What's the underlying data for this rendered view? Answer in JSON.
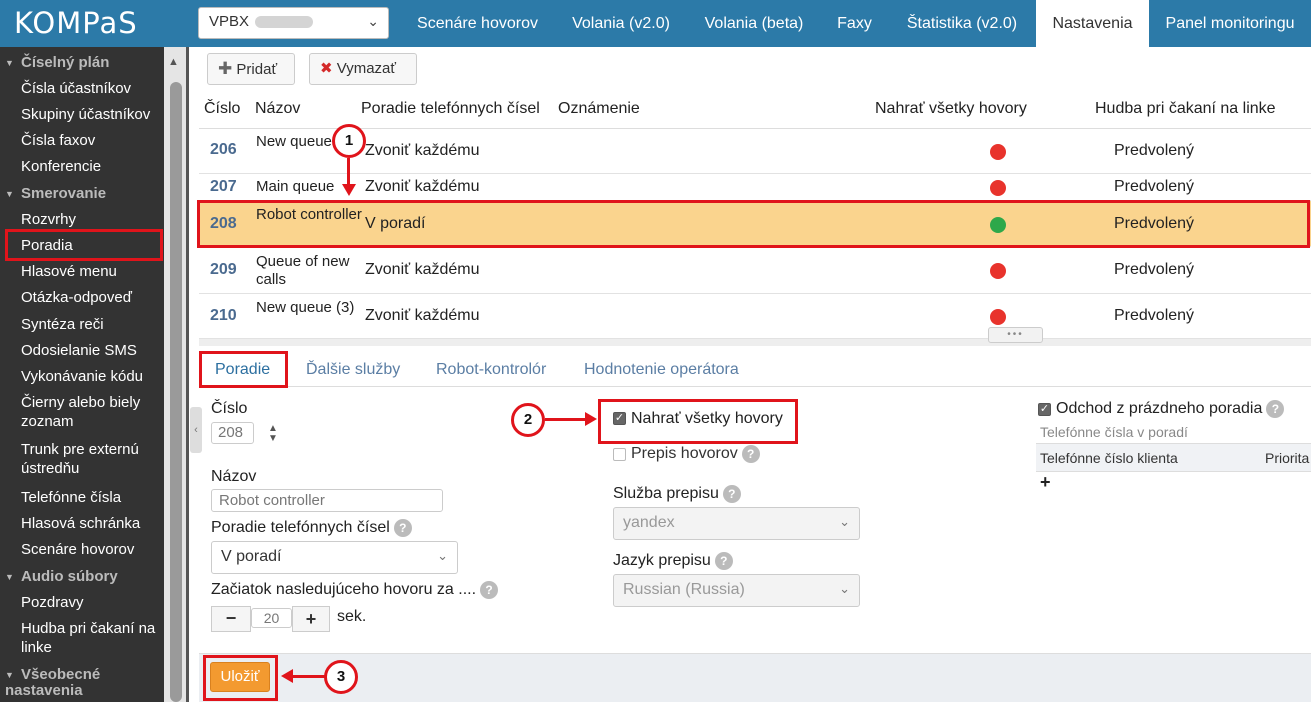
{
  "header": {
    "logo": "KOMPaS",
    "account_select": "VPBX",
    "nav_tabs": [
      "Scenáre hovorov",
      "Volania (v2.0)",
      "Volania (beta)",
      "Faxy",
      "Štatistika (v2.0)",
      "Nastavenia",
      "Panel monitoringu"
    ],
    "active_tab": "Nastavenia"
  },
  "sidebar": {
    "items": [
      {
        "label": "Číselný plán",
        "type": "section"
      },
      {
        "label": "Čísla účastníkov",
        "type": "item"
      },
      {
        "label": "Skupiny účastníkov",
        "type": "item"
      },
      {
        "label": "Čísla faxov",
        "type": "item"
      },
      {
        "label": "Konferencie",
        "type": "item"
      },
      {
        "label": "Smerovanie",
        "type": "section"
      },
      {
        "label": "Rozvrhy",
        "type": "item"
      },
      {
        "label": "Poradia",
        "type": "item",
        "active": true
      },
      {
        "label": "Hlasové menu",
        "type": "item"
      },
      {
        "label": "Otázka-odpoveď",
        "type": "item"
      },
      {
        "label": "Syntéza reči",
        "type": "item"
      },
      {
        "label": "Odosielanie SMS",
        "type": "item"
      },
      {
        "label": "Vykonávanie kódu",
        "type": "item"
      },
      {
        "label": "Čierny alebo biely zoznam",
        "type": "item"
      },
      {
        "label": "Trunk pre externú ústredňu",
        "type": "item"
      },
      {
        "label": "Telefónne čísla",
        "type": "item"
      },
      {
        "label": "Hlasová schránka",
        "type": "item"
      },
      {
        "label": "Scenáre hovorov",
        "type": "item"
      },
      {
        "label": "Audio súbory",
        "type": "section"
      },
      {
        "label": "Pozdravy",
        "type": "item"
      },
      {
        "label": "Hudba pri čakaní na linke",
        "type": "item"
      },
      {
        "label": "Všeobecné nastavenia",
        "type": "section"
      }
    ]
  },
  "toolbar": {
    "add_label": "Pridať",
    "delete_label": "Vymazať"
  },
  "table": {
    "columns": [
      "Číslo",
      "Názov",
      "Poradie telefónnych čísel",
      "Oznámenie",
      "Nahrať všetky hovory",
      "Hudba pri čakaní na linke"
    ],
    "rows": [
      {
        "number": "206",
        "name": "New queue (2)",
        "order": "Zvoniť každému",
        "record": false,
        "music": "Predvolený"
      },
      {
        "number": "207",
        "name": "Main queue",
        "order": "Zvoniť každému",
        "record": false,
        "music": "Predvolený"
      },
      {
        "number": "208",
        "name": "Robot controller",
        "order": "V poradí",
        "record": true,
        "music": "Predvolený",
        "selected": true
      },
      {
        "number": "209",
        "name": "Queue of new calls",
        "order": "Zvoniť každému",
        "record": false,
        "music": "Predvolený"
      },
      {
        "number": "210",
        "name": "New queue (3)",
        "order": "Zvoniť každému",
        "record": false,
        "music": "Predvolený"
      }
    ]
  },
  "detail_tabs": [
    "Poradie",
    "Ďalšie služby",
    "Robot-kontrolór",
    "Hodnotenie operátora"
  ],
  "form": {
    "number_label": "Číslo",
    "number_value": "208",
    "name_label": "Názov",
    "name_value": "Robot controller",
    "order_label": "Poradie telefónnych čísel",
    "order_value": "V poradí",
    "next_call_label": "Začiatok nasledujúceho hovoru za ....",
    "next_call_value": "20",
    "next_call_unit": "sek.",
    "record_all_label": "Nahrať všetky hovory",
    "record_all_checked": true,
    "transcribe_label": "Prepis hovorov",
    "transcribe_checked": false,
    "transcribe_service_label": "Služba prepisu",
    "transcribe_service_value": "yandex",
    "transcribe_lang_label": "Jazyk prepisu",
    "transcribe_lang_value": "Russian (Russia)",
    "leave_empty_label": "Odchod z prázdneho poradia",
    "leave_empty_checked": true,
    "queue_numbers_label": "Telefónne čísla v poradí",
    "queue_col_phone": "Telefónne číslo klienta",
    "queue_col_priority": "Priorita"
  },
  "save_label": "Uložiť",
  "annotations": [
    "1",
    "2",
    "3"
  ],
  "colors": {
    "topbar": "#2c7aa8",
    "sidebar": "#333333",
    "selected_row": "#fad48e",
    "annotation": "#e0141b",
    "save": "#f39a30",
    "dot_on": "#2ea84a",
    "dot_off": "#e8332c"
  }
}
